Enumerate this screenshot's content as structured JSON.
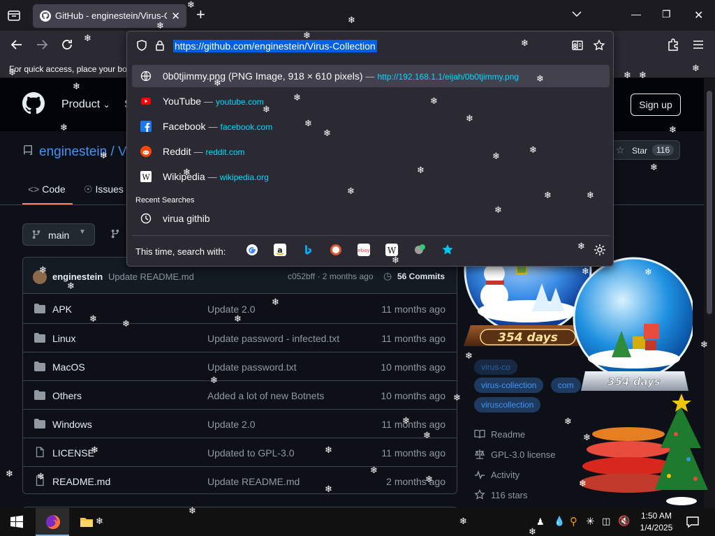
{
  "browser": {
    "tab_title": "GitHub - enginestein/Virus-Collection",
    "url": "https://github.com/enginestein/Virus-Collection",
    "bookmarks_hint": "For quick access, place your boo"
  },
  "url_dropdown": {
    "suggestions": [
      {
        "name": "0b0tjimmy.png (PNG Image, 918 × 610 pixels)",
        "url": "http://192.168.1.1/eijah/0b0tjimmy.png"
      },
      {
        "name": "YouTube",
        "url": "youtube.com"
      },
      {
        "name": "Facebook",
        "url": "facebook.com"
      },
      {
        "name": "Reddit",
        "url": "reddit.com"
      },
      {
        "name": "Wikipedia",
        "url": "wikipedia.org"
      }
    ],
    "dash": "—",
    "recent_header": "Recent Searches",
    "recent": [
      "virua githib"
    ],
    "search_with": "This time, search with:"
  },
  "github": {
    "product": "Product",
    "sign_up": "Sign up",
    "owner": "enginestein",
    "repo_sep": "/ V",
    "star_label": "Star",
    "star_count": "116",
    "tabs": [
      "Code",
      "Issues"
    ],
    "branch": "main",
    "commit": {
      "author": "enginestein",
      "message": "Update README.md",
      "hash_time": "c052bff · 2 months ago",
      "commits": "56 Commits"
    },
    "files": [
      {
        "name": "APK",
        "msg": "Update 2.0",
        "age": "11 months ago",
        "type": "folder"
      },
      {
        "name": "Linux",
        "msg": "Update password - infected.txt",
        "age": "11 months ago",
        "type": "folder"
      },
      {
        "name": "MacOS",
        "msg": "Update password.txt",
        "age": "10 months ago",
        "type": "folder"
      },
      {
        "name": "Others",
        "msg": "Added a lot of new Botnets",
        "age": "10 months ago",
        "type": "folder"
      },
      {
        "name": "Windows",
        "msg": "Update 2.0",
        "age": "11 months ago",
        "type": "folder"
      },
      {
        "name": "LICENSE",
        "msg": "Updated to GPL-3.0",
        "age": "11 months ago",
        "type": "file"
      },
      {
        "name": "README.md",
        "msg": "Update README.md",
        "age": "2 months ago",
        "type": "file"
      }
    ],
    "topics": [
      "virus-collection",
      "com",
      "viruscollection"
    ],
    "sidebar": [
      "Readme",
      "GPL-3.0 license",
      "Activity",
      "116 stars"
    ]
  },
  "desktop_widget": {
    "globe1_label": "354 days",
    "globe2_label": "354 days"
  },
  "taskbar": {
    "time": "1:50 AM",
    "date": "1/4/2025"
  },
  "colors": {
    "accent_blue": "#4493f8",
    "url_highlight": "#0060df",
    "tab_underline": "#f78166",
    "link_cyan": "#00ddff"
  }
}
